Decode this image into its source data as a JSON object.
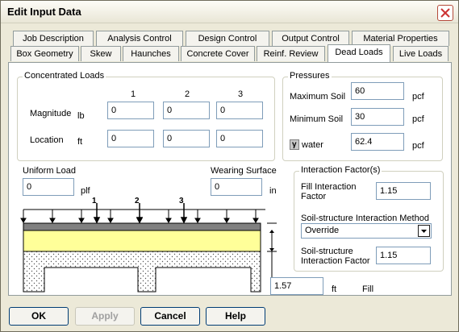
{
  "window": {
    "title": "Edit Input Data"
  },
  "tabs_back": [
    "Job Description",
    "Analysis Control",
    "Design Control",
    "Output Control",
    "Material Properties"
  ],
  "tabs_front": [
    "Box Geometry",
    "Skew",
    "Haunches",
    "Concrete Cover",
    "Reinf. Review",
    "Dead Loads",
    "Live Loads"
  ],
  "active_tab": "Dead Loads",
  "concentrated_loads": {
    "group_label": "Concentrated Loads",
    "col_headers": [
      "1",
      "2",
      "3"
    ],
    "magnitude_label": "Magnitude",
    "magnitude_unit": "lb",
    "location_label": "Location",
    "location_unit": "ft",
    "magnitude_values": [
      "0",
      "0",
      "0"
    ],
    "location_values": [
      "0",
      "0",
      "0"
    ]
  },
  "pressures": {
    "group_label": "Pressures",
    "max_soil_label": "Maximum Soil",
    "max_soil_value": "60",
    "min_soil_label": "Minimum Soil",
    "min_soil_value": "30",
    "water_symbol": "γ",
    "water_label": "water",
    "water_value": "62.4",
    "unit": "pcf"
  },
  "uniform_load": {
    "label": "Uniform Load",
    "value": "0",
    "unit": "plf"
  },
  "wearing_surface": {
    "label": "Wearing Surface",
    "value": "0",
    "unit": "in"
  },
  "diagram": {
    "load_markers": [
      "1",
      "2",
      "3"
    ]
  },
  "fill": {
    "value": "1.57",
    "unit": "ft",
    "label": "Fill"
  },
  "interaction": {
    "group_label": "Interaction Factor(s)",
    "fill_factor_label_1": "Fill Interaction",
    "fill_factor_label_2": "Factor",
    "fill_factor_value": "1.15",
    "method_label": "Soil-structure Interaction Method",
    "method_value": "Override",
    "ssi_label_1": "Soil-structure",
    "ssi_label_2": "Interaction Factor",
    "ssi_value": "1.15"
  },
  "buttons": {
    "ok": "OK",
    "apply": "Apply",
    "cancel": "Cancel",
    "help": "Help"
  }
}
